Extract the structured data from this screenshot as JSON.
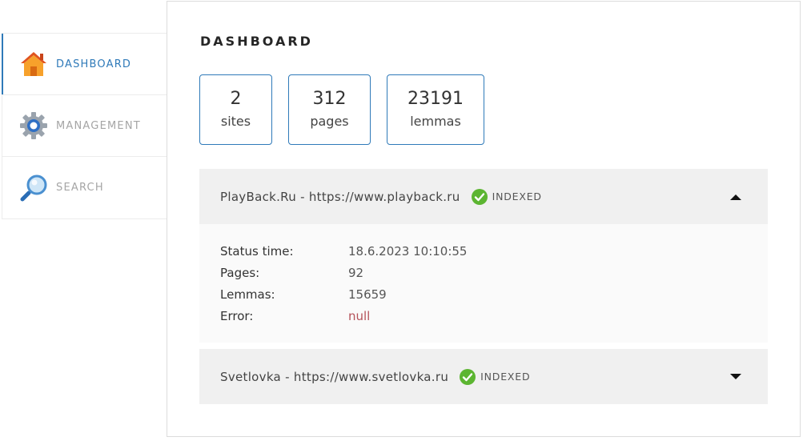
{
  "sidebar": {
    "items": [
      {
        "label": "DASHBOARD",
        "icon": "home-icon",
        "active": true
      },
      {
        "label": "MANAGEMENT",
        "icon": "gear-icon",
        "active": false
      },
      {
        "label": "SEARCH",
        "icon": "magnifier-icon",
        "active": false
      }
    ]
  },
  "main": {
    "title": "DASHBOARD",
    "stats": [
      {
        "value": "2",
        "label": "sites"
      },
      {
        "value": "312",
        "label": "pages"
      },
      {
        "value": "23191",
        "label": "lemmas"
      }
    ],
    "sites": [
      {
        "name": "PlayBack.Ru - https://www.playback.ru",
        "status": "INDEXED",
        "expanded": true,
        "details": [
          {
            "key": "Status time:",
            "value": "18.6.2023 10:10:55"
          },
          {
            "key": "Pages:",
            "value": "92"
          },
          {
            "key": "Lemmas:",
            "value": "15659"
          },
          {
            "key": "Error:",
            "value": "null"
          }
        ]
      },
      {
        "name": "Svetlovka - https://www.svetlovka.ru",
        "status": "INDEXED",
        "expanded": false
      }
    ]
  },
  "colors": {
    "accent": "#2f7ab9",
    "status_ok": "#5cb531",
    "error": "#b5525a"
  }
}
